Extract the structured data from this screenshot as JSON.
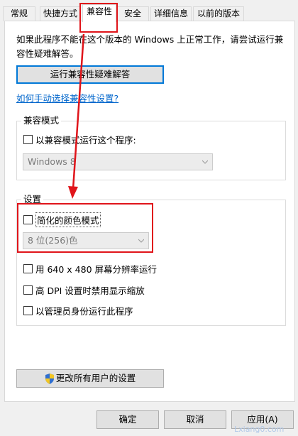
{
  "tabs": [
    {
      "label": "常规"
    },
    {
      "label": "快捷方式"
    },
    {
      "label": "兼容性"
    },
    {
      "label": "安全"
    },
    {
      "label": "详细信息"
    },
    {
      "label": "以前的版本"
    }
  ],
  "description": "如果此程序不能在这个版本的 Windows 上正常工作，请尝试运行兼容性疑难解答。",
  "troubleshoot_button": "运行兼容性疑难解答",
  "manual_link": "如何手动选择兼容性设置?",
  "compat_mode": {
    "title": "兼容模式",
    "checkbox_label": "以兼容模式运行这个程序:",
    "select_value": "Windows 8"
  },
  "settings": {
    "title": "设置",
    "reduced_color_label": "简化的颜色模式",
    "color_select_value": "8 位(256)色",
    "resolution_label": "用 640 x 480 屏幕分辨率运行",
    "dpi_label": "高 DPI 设置时禁用显示缩放",
    "admin_label": "以管理员身份运行此程序"
  },
  "change_all_button": "更改所有用户的设置",
  "footer": {
    "ok": "确定",
    "cancel": "取消",
    "apply": "应用(A)"
  },
  "watermark": "Lxiang0.com",
  "colors": {
    "annotation_red": "#e0141a",
    "focus_blue": "#0078d7",
    "link_blue": "#0066cc"
  }
}
